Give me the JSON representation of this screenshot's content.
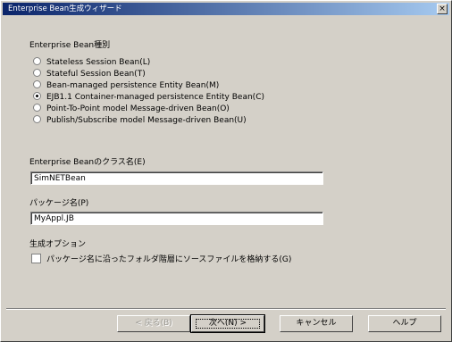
{
  "window": {
    "title": "Enterprise Bean生成ウィザード",
    "close_glyph": "×"
  },
  "bean_type": {
    "label": "Enterprise Bean種別",
    "options": [
      "Stateless Session Bean(L)",
      "Stateful Session Bean(T)",
      "Bean-managed persistence Entity Bean(M)",
      "EJB1.1 Container-managed persistence Entity Bean(C)",
      "Point-To-Point model Message-driven Bean(O)",
      "Publish/Subscribe model Message-driven Bean(U)"
    ],
    "selected_index": 3
  },
  "class_name": {
    "label": "Enterprise Beanのクラス名(E)",
    "value": "SimNETBean"
  },
  "package_name": {
    "label": "パッケージ名(P)",
    "value": "MyAppl.JB"
  },
  "options": {
    "label": "生成オプション",
    "checkbox_label": "パッケージ名に沿ったフォルダ階層にソースファイルを格納する(G)",
    "checked": false
  },
  "buttons": {
    "back": "< 戻る(B)",
    "next": "次へ(N) >",
    "cancel": "キャンセル",
    "help": "ヘルプ"
  }
}
